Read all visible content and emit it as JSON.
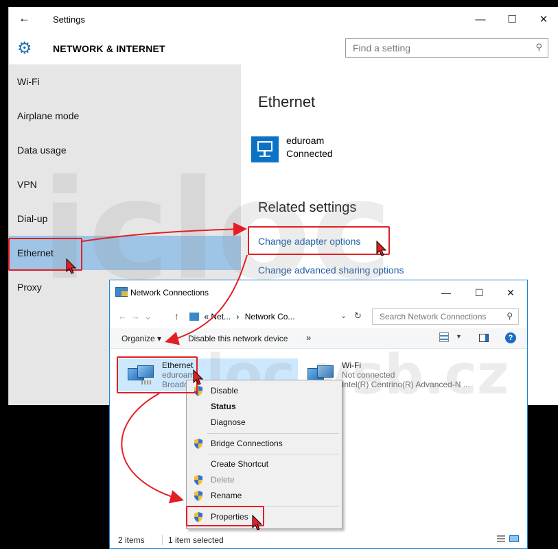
{
  "settings": {
    "window_title": "Settings",
    "section_title": "NETWORK & INTERNET",
    "search_placeholder": "Find a setting",
    "nav": [
      {
        "label": "Wi-Fi"
      },
      {
        "label": "Airplane mode"
      },
      {
        "label": "Data usage"
      },
      {
        "label": "VPN"
      },
      {
        "label": "Dial-up"
      },
      {
        "label": "Ethernet",
        "active": true
      },
      {
        "label": "Proxy"
      }
    ],
    "content": {
      "heading": "Ethernet",
      "connection_name": "eduroam",
      "connection_status": "Connected",
      "related_heading": "Related settings",
      "link_adapter": "Change adapter options",
      "link_sharing": "Change advanced sharing options"
    }
  },
  "network_connections": {
    "window_title": "Network Connections",
    "path_part1": "« Net...",
    "path_sep": "›",
    "path_part2": "Network Co...",
    "search_placeholder": "Search Network Connections",
    "toolbar": {
      "organize": "Organize ▾",
      "disable": "Disable this network device",
      "more": "»"
    },
    "adapters": [
      {
        "name": "Ethernet",
        "line2": "eduroam",
        "line3": "Broadc"
      },
      {
        "name": "Wi-Fi",
        "line2": "Not connected",
        "line3": "Intel(R) Centrino(R) Advanced-N ..."
      }
    ],
    "status": {
      "items": "2 items",
      "selected": "1 item selected"
    }
  },
  "context_menu": {
    "items": [
      {
        "label": "Disable",
        "shield": true
      },
      {
        "label": "Status",
        "bold": true
      },
      {
        "label": "Diagnose"
      },
      {
        "label": "Bridge Connections",
        "shield": true
      },
      {
        "label": "Create Shortcut"
      },
      {
        "label": "Delete",
        "shield": true,
        "disabled": true
      },
      {
        "label": "Rename",
        "shield": true
      },
      {
        "label": "Properties",
        "shield": true
      }
    ]
  },
  "window_controls": {
    "minimize": "—",
    "maximize": "☐",
    "close": "✕"
  },
  "icons": {
    "back": "back-arrow-icon",
    "gear": "gear-icon",
    "search": "search-icon",
    "shield": "uac-shield-icon",
    "cursor": "mouse-cursor-icon"
  },
  "watermark": {
    "top": "icloc",
    "bottom": "loc.vsb.cz"
  },
  "colors": {
    "accent": "#0b73c6",
    "link": "#1a5fa8",
    "nav_active": "#9ec4e6",
    "highlight": "#e31e24",
    "selected_item": "#cce8ff"
  }
}
